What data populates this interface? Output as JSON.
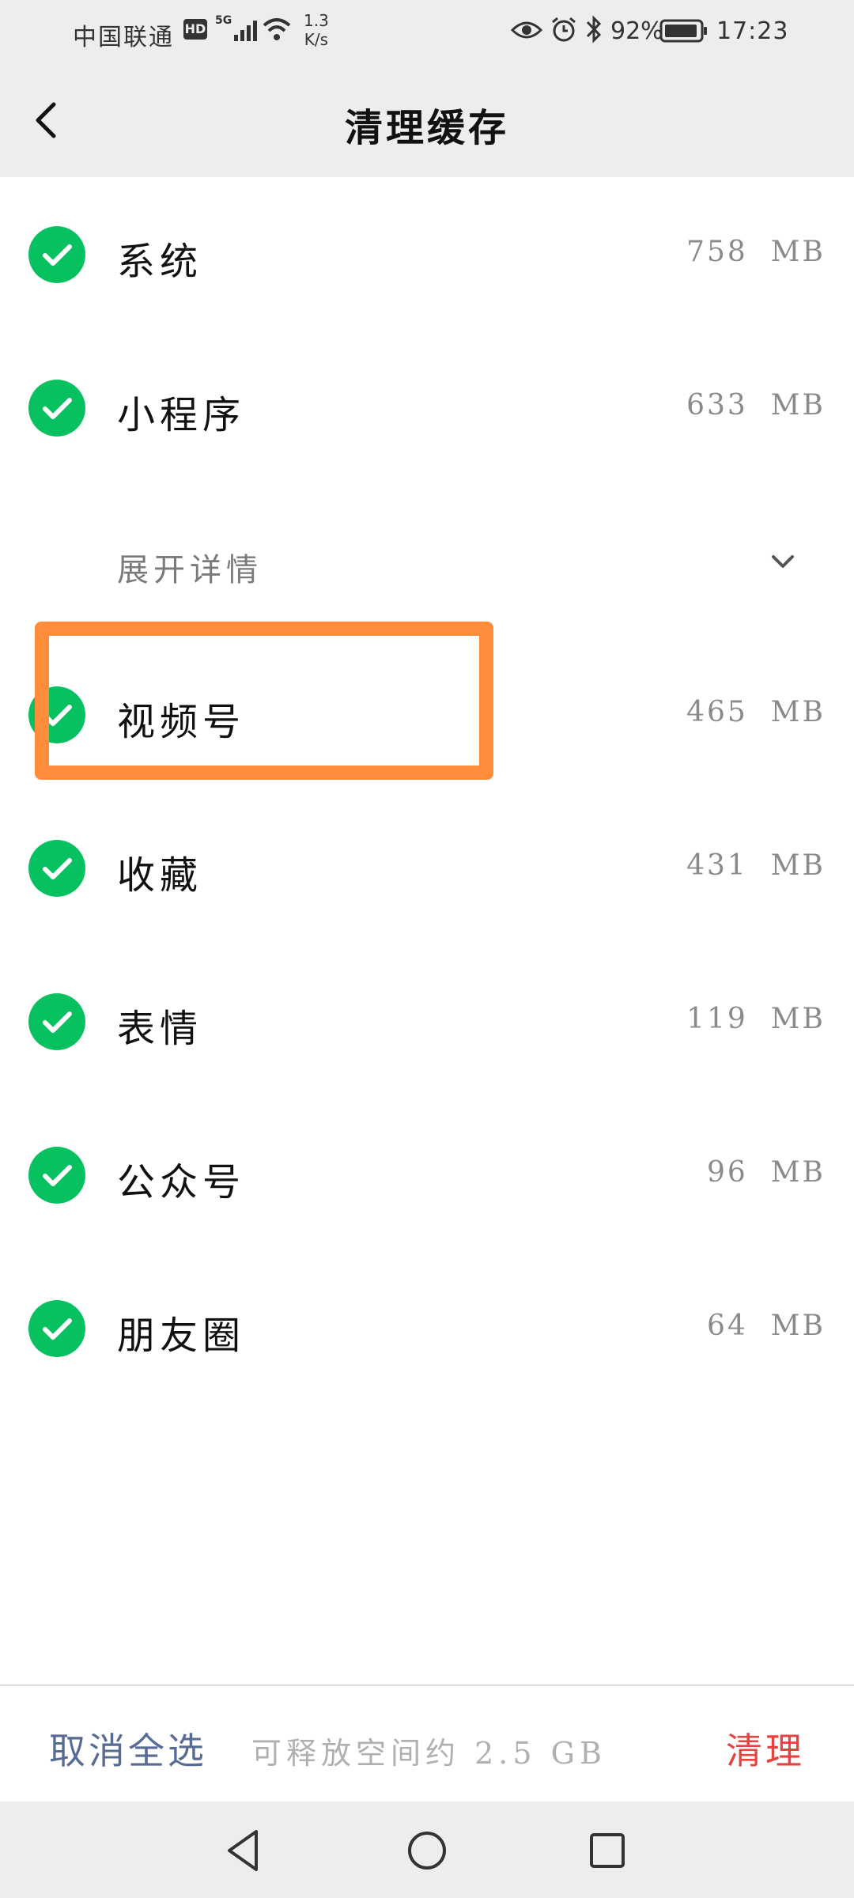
{
  "status_bar": {
    "carrier": "中国联通",
    "hd": "HD",
    "network_gen": "5G",
    "speed_value": "1.3",
    "speed_unit": "K/s",
    "battery_percent": "92%",
    "time": "17:23"
  },
  "header": {
    "title": "清理缓存",
    "back_icon": "chevron-left-icon"
  },
  "cache_items": [
    {
      "label": "系统",
      "size": "758  MB",
      "checked": true
    },
    {
      "label": "小程序",
      "size": "633  MB",
      "checked": true
    },
    {
      "label": "视频号",
      "size": "465  MB",
      "checked": true
    },
    {
      "label": "收藏",
      "size": "431  MB",
      "checked": true
    },
    {
      "label": "表情",
      "size": "119  MB",
      "checked": true
    },
    {
      "label": "公众号",
      "size": "96  MB",
      "checked": true
    },
    {
      "label": "朋友圈",
      "size": "64  MB",
      "checked": true
    }
  ],
  "expand": {
    "label": "展开详情",
    "icon": "chevron-down-icon"
  },
  "bottom_bar": {
    "deselect_all": "取消全选",
    "free_space": "可释放空间约 2.5 GB",
    "clean": "清理"
  },
  "colors": {
    "check_green": "#07c160",
    "link_blue": "#576b95",
    "danger_red": "#e64340",
    "highlight_orange": "#ff8c3a"
  }
}
